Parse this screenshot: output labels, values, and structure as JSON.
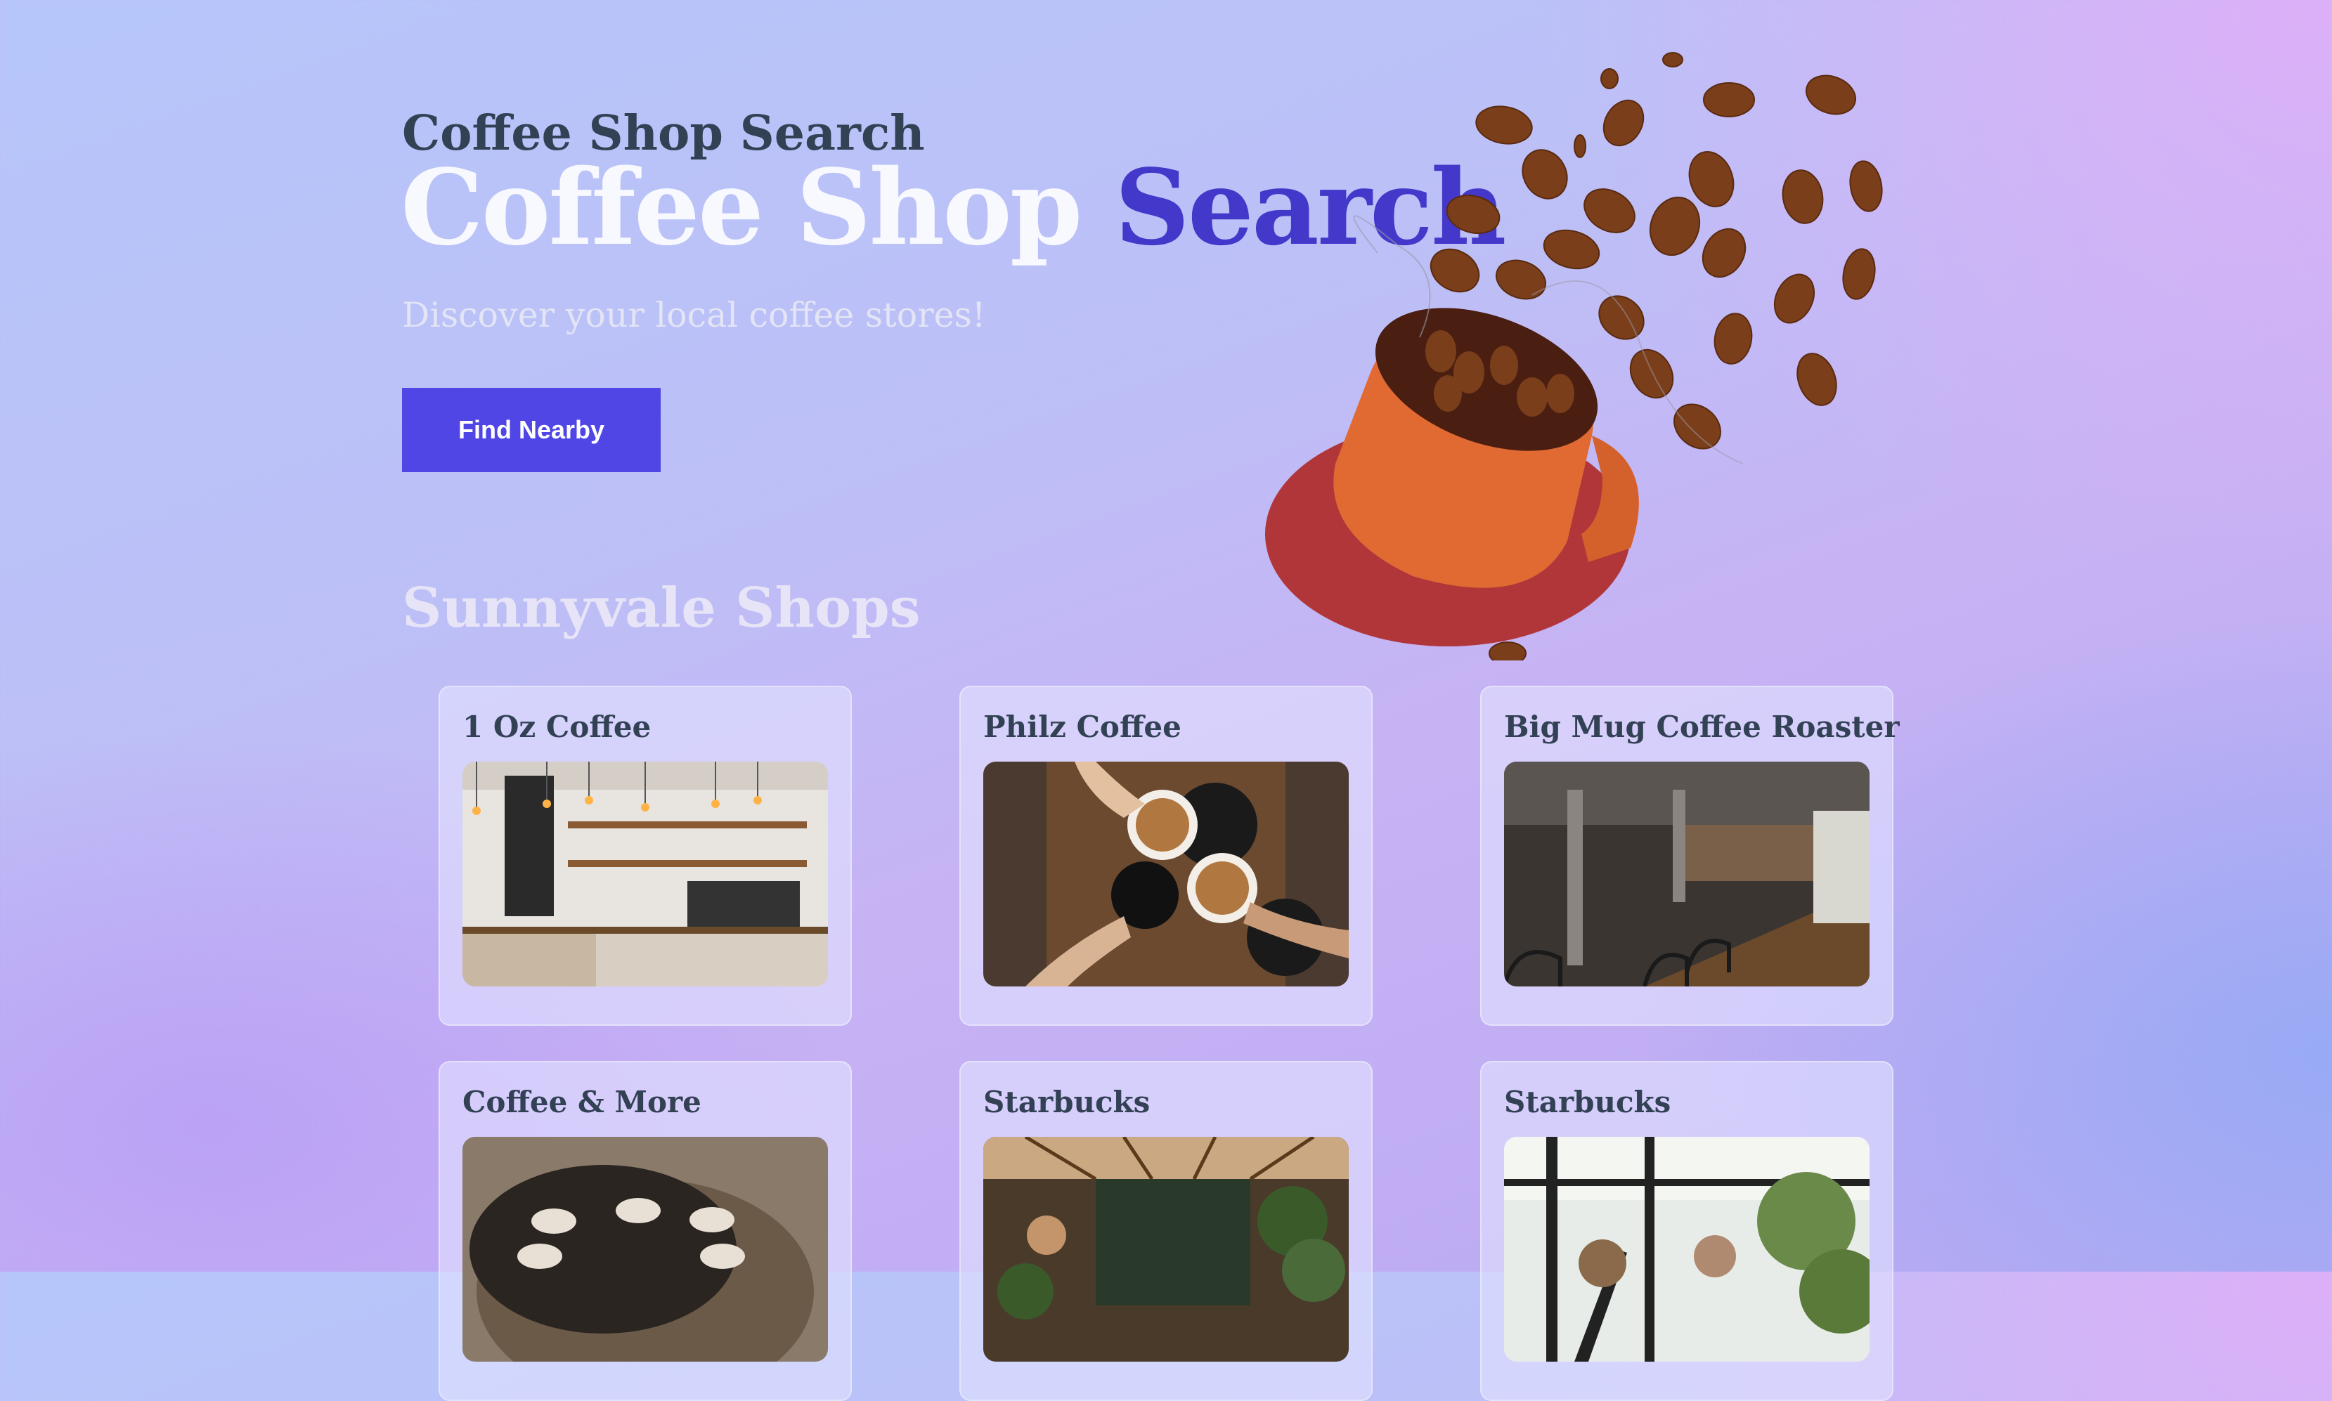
{
  "hero": {
    "small_title": "Coffee Shop Search",
    "big_title_part1": "Coffee Shop",
    "big_title_part2": "Search",
    "subtitle": "Discover your local coffee stores!",
    "cta_label": "Find Nearby"
  },
  "section": {
    "title": "Sunnyvale Shops"
  },
  "shops": [
    {
      "name": "1 Oz Coffee"
    },
    {
      "name": "Philz Coffee"
    },
    {
      "name": "Big Mug Coffee Roaster"
    },
    {
      "name": "Coffee & More"
    },
    {
      "name": "Starbucks"
    },
    {
      "name": "Starbucks"
    }
  ],
  "colors": {
    "accent": "#4f46e5",
    "title_blue": "#4338ca",
    "text_dark": "#334155"
  }
}
